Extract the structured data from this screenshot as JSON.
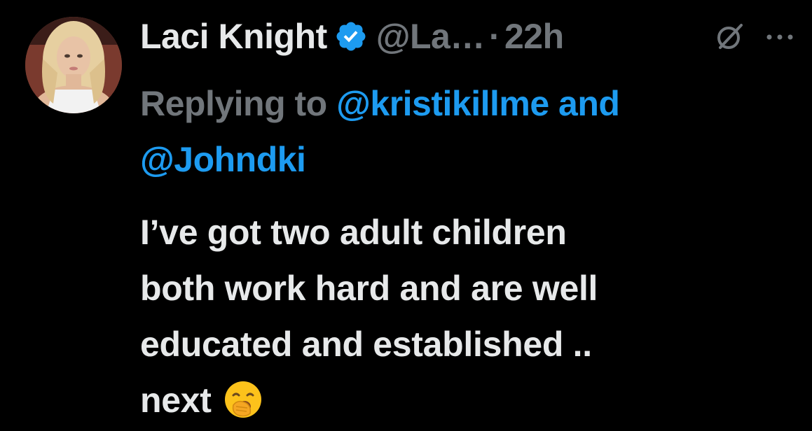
{
  "tweet": {
    "author": {
      "display_name": "Laci Knight",
      "handle": "@La…",
      "verified": true,
      "verified_color": "#1d9bf0"
    },
    "separator": "·",
    "time": "22h",
    "grok_icon": "grok-icon",
    "more_icon": "more-icon",
    "reply": {
      "prefix": "Replying to",
      "mention_1": "@kristikillme",
      "conjunction": "and",
      "mention_2": "@Johndki"
    },
    "text": {
      "line_1": "I’ve got two adult children",
      "line_2": "both work hard and are well",
      "line_3": "educated and established ..",
      "line_4": "next",
      "emoji": "yawning-face-emoji"
    },
    "colors": {
      "background": "#000000",
      "primary_text": "#e7e9ea",
      "secondary_text": "#71767b",
      "link": "#1d9bf0"
    }
  }
}
